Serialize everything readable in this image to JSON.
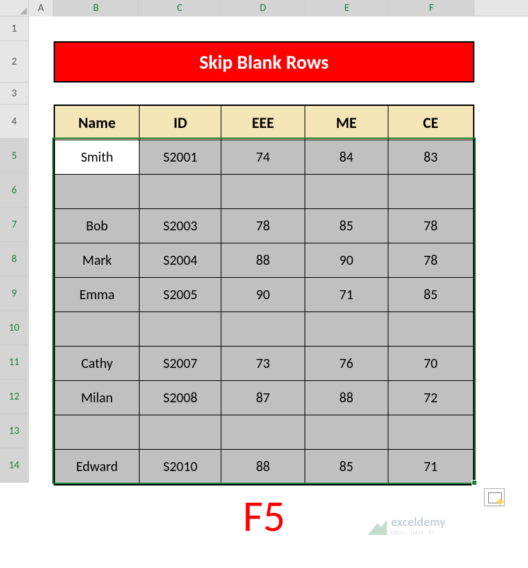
{
  "columns": [
    "A",
    "B",
    "C",
    "D",
    "E",
    "F"
  ],
  "row_numbers": [
    1,
    2,
    3,
    4,
    5,
    6,
    7,
    8,
    9,
    10,
    11,
    12,
    13,
    14
  ],
  "title": "Skip Blank Rows",
  "headers": {
    "B": "Name",
    "C": "ID",
    "D": "EEE",
    "E": "ME",
    "F": "CE"
  },
  "rows": [
    {
      "B": "Smith",
      "C": "S2001",
      "D": 74,
      "E": 84,
      "F": 83
    },
    {
      "B": "",
      "C": "",
      "D": "",
      "E": "",
      "F": ""
    },
    {
      "B": "Bob",
      "C": "S2003",
      "D": 78,
      "E": 85,
      "F": 78
    },
    {
      "B": "Mark",
      "C": "S2004",
      "D": 88,
      "E": 90,
      "F": 78
    },
    {
      "B": "Emma",
      "C": "S2005",
      "D": 90,
      "E": 71,
      "F": 85
    },
    {
      "B": "",
      "C": "",
      "D": "",
      "E": "",
      "F": ""
    },
    {
      "B": "Cathy",
      "C": "S2007",
      "D": 73,
      "E": 76,
      "F": 70
    },
    {
      "B": "Milan",
      "C": "S2008",
      "D": 87,
      "E": 88,
      "F": 72
    },
    {
      "B": "",
      "C": "",
      "D": "",
      "E": "",
      "F": ""
    },
    {
      "B": "Edward",
      "C": "S2010",
      "D": 88,
      "E": 85,
      "F": 71
    }
  ],
  "active_cell": "B5",
  "selection_range": "B5:F14",
  "big_label": "F5",
  "watermark": {
    "brand": "exceldemy",
    "tagline": "EXCEL · DATA · BI"
  },
  "quick_analysis_tooltip": "Quick Analysis",
  "chart_data": {
    "type": "table",
    "title": "Skip Blank Rows",
    "columns": [
      "Name",
      "ID",
      "EEE",
      "ME",
      "CE"
    ],
    "rows": [
      [
        "Smith",
        "S2001",
        74,
        84,
        83
      ],
      [
        "",
        "",
        "",
        "",
        ""
      ],
      [
        "Bob",
        "S2003",
        78,
        85,
        78
      ],
      [
        "Mark",
        "S2004",
        88,
        90,
        78
      ],
      [
        "Emma",
        "S2005",
        90,
        71,
        85
      ],
      [
        "",
        "",
        "",
        "",
        ""
      ],
      [
        "Cathy",
        "S2007",
        73,
        76,
        70
      ],
      [
        "Milan",
        "S2008",
        87,
        88,
        72
      ],
      [
        "",
        "",
        "",
        "",
        ""
      ],
      [
        "Edward",
        "S2010",
        88,
        85,
        71
      ]
    ]
  }
}
